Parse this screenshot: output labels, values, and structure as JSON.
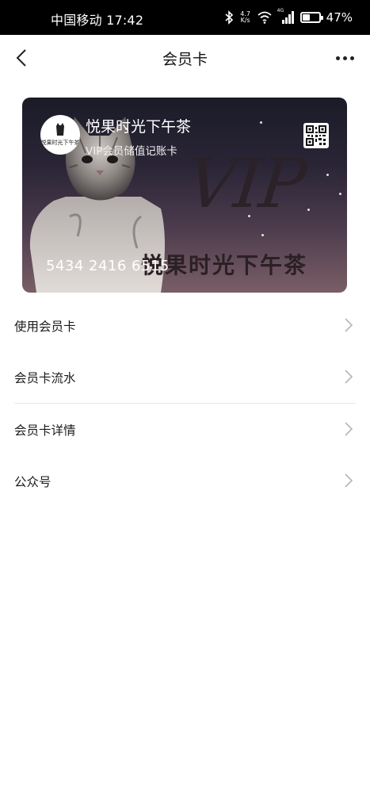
{
  "status_bar": {
    "carrier_time": "中国移动 17:42",
    "net_speed_value": "4.7",
    "net_speed_unit": "K/s",
    "signal_label": "4G",
    "battery_percent": "47%",
    "battery_level": 0.47
  },
  "nav": {
    "title": "会员卡"
  },
  "card": {
    "logo_text": "悦果时光下午茶",
    "name": "悦果时光下午茶",
    "type": "VIP会员储值记账卡",
    "vip_text": "VIP",
    "brand_text": "悦果时光下午茶",
    "number": "5434 2416 6515"
  },
  "menu": {
    "items": [
      {
        "label": "使用会员卡"
      },
      {
        "label": "会员卡流水"
      },
      {
        "label": "会员卡详情"
      },
      {
        "label": "公众号"
      }
    ]
  },
  "colors": {
    "card_top": "#1b1b28",
    "card_bottom": "#7a5e66",
    "text_primary": "#1a1a1a",
    "chevron": "#b5b5b5",
    "divider": "#e8e8e8"
  },
  "icons": [
    "bluetooth-icon",
    "wifi-icon",
    "signal-icon",
    "battery-icon",
    "back-icon",
    "more-icon",
    "qr-code-icon",
    "chevron-right-icon",
    "cat-image"
  ]
}
